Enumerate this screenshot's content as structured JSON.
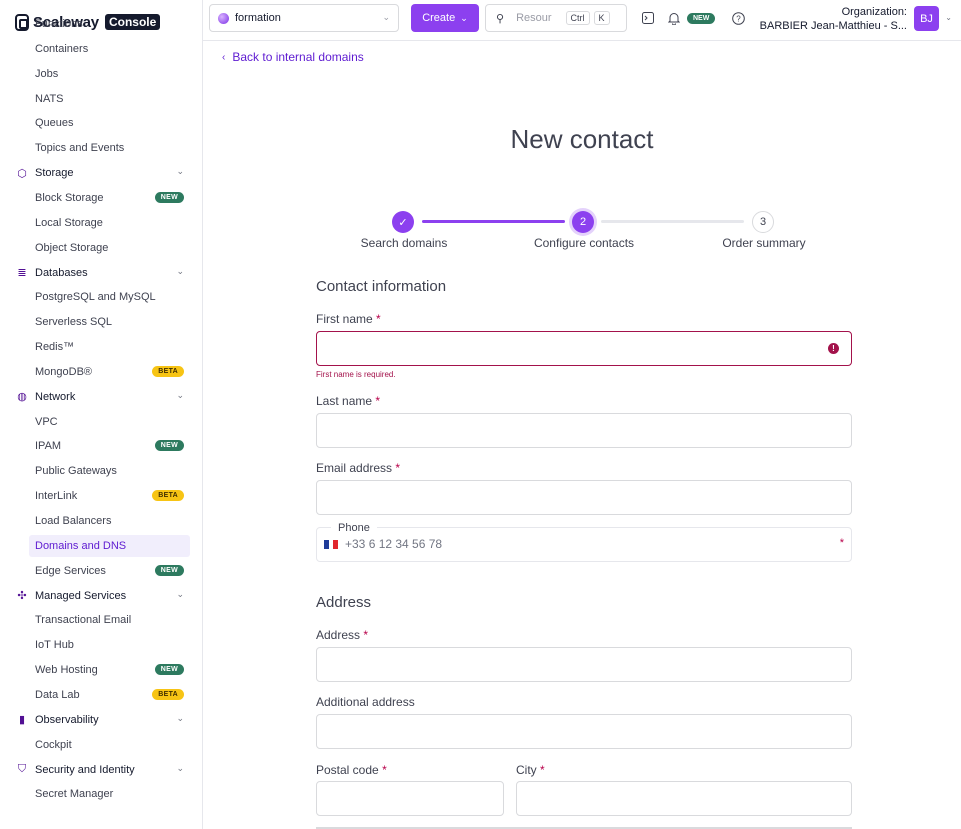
{
  "brand": {
    "name": "Scaleway",
    "console": "Console"
  },
  "topbar": {
    "project": "formation",
    "create_label": "Create",
    "search_placeholder": "Resour",
    "kbd_ctrl": "Ctrl",
    "kbd_k": "K",
    "new_badge": "NEW",
    "org_label": "Organization:",
    "org_user": "BARBIER Jean-Matthieu - S...",
    "avatar_initials": "BJ"
  },
  "sidebar": {
    "items": [
      {
        "label": "Functions",
        "type": "item"
      },
      {
        "label": "Containers",
        "type": "item"
      },
      {
        "label": "Jobs",
        "type": "item"
      },
      {
        "label": "NATS",
        "type": "item"
      },
      {
        "label": "Queues",
        "type": "item"
      },
      {
        "label": "Topics and Events",
        "type": "item"
      },
      {
        "label": "Storage",
        "type": "group",
        "icon": "storage-icon"
      },
      {
        "label": "Block Storage",
        "type": "item",
        "badge": "NEW"
      },
      {
        "label": "Local Storage",
        "type": "item"
      },
      {
        "label": "Object Storage",
        "type": "item"
      },
      {
        "label": "Databases",
        "type": "group",
        "icon": "database-icon"
      },
      {
        "label": "PostgreSQL and MySQL",
        "type": "item"
      },
      {
        "label": "Serverless SQL",
        "type": "item"
      },
      {
        "label": "Redis™",
        "type": "item"
      },
      {
        "label": "MongoDB®",
        "type": "item",
        "badge": "BETA"
      },
      {
        "label": "Network",
        "type": "group",
        "icon": "globe-icon"
      },
      {
        "label": "VPC",
        "type": "item"
      },
      {
        "label": "IPAM",
        "type": "item",
        "badge": "NEW"
      },
      {
        "label": "Public Gateways",
        "type": "item"
      },
      {
        "label": "InterLink",
        "type": "item",
        "badge": "BETA"
      },
      {
        "label": "Load Balancers",
        "type": "item"
      },
      {
        "label": "Domains and DNS",
        "type": "item",
        "active": true
      },
      {
        "label": "Edge Services",
        "type": "item",
        "badge": "NEW"
      },
      {
        "label": "Managed Services",
        "type": "group",
        "icon": "managed-services-icon"
      },
      {
        "label": "Transactional Email",
        "type": "item"
      },
      {
        "label": "IoT Hub",
        "type": "item"
      },
      {
        "label": "Web Hosting",
        "type": "item",
        "badge": "NEW"
      },
      {
        "label": "Data Lab",
        "type": "item",
        "badge": "BETA"
      },
      {
        "label": "Observability",
        "type": "group",
        "icon": "observability-icon"
      },
      {
        "label": "Cockpit",
        "type": "item"
      },
      {
        "label": "Security and Identity",
        "type": "group",
        "icon": "shield-icon"
      },
      {
        "label": "Secret Manager",
        "type": "item"
      }
    ]
  },
  "main": {
    "back_link": "Back to internal domains",
    "title": "New contact",
    "steps": [
      {
        "label": "Search domains",
        "state": "done",
        "marker": "✓"
      },
      {
        "label": "Configure contacts",
        "state": "current",
        "marker": "2"
      },
      {
        "label": "Order summary",
        "state": "upcoming",
        "marker": "3"
      }
    ],
    "contact_section": "Contact information",
    "first_name_label": "First name",
    "first_name_error": "First name is required.",
    "last_name_label": "Last name",
    "email_label": "Email address",
    "phone_label": "Phone",
    "phone_placeholder": "+33 6 12 34 56 78",
    "address_section": "Address",
    "address_label": "Address",
    "additional_address_label": "Additional address",
    "postal_code_label": "Postal code",
    "city_label": "City",
    "required_mark": "*"
  },
  "colors": {
    "primary": "#8c40ef",
    "primary_dark": "#5e1bd1",
    "error": "#a3124b",
    "badge_new": "#2d7a5f",
    "badge_beta": "#f7c414"
  }
}
